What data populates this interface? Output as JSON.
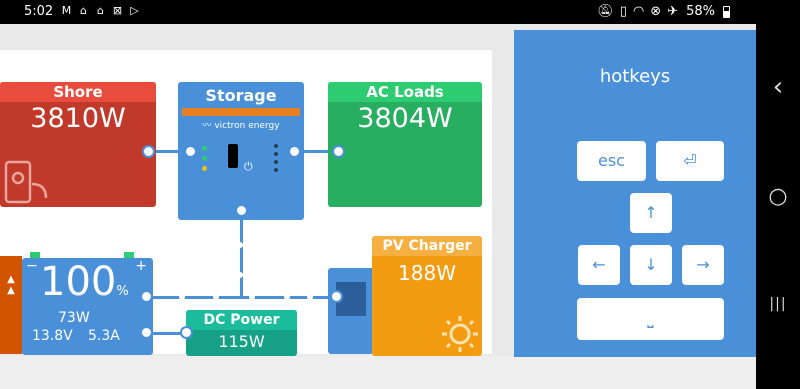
{
  "status_bar": {
    "time": "5:02",
    "battery": "58%"
  },
  "dashboard": {
    "shore": {
      "title": "Shore",
      "value": "3810W"
    },
    "storage": {
      "title": "Storage",
      "brand": "victron energy"
    },
    "ac_loads": {
      "title": "AC Loads",
      "value": "3804W"
    },
    "battery": {
      "percent": "100",
      "percent_unit": "%",
      "power": "73W",
      "voltage": "13.8V",
      "current": "5.3A"
    },
    "dc_power": {
      "title": "DC Power",
      "value": "115W"
    },
    "pv_charger": {
      "title": "PV Charger",
      "value": "188W"
    }
  },
  "hotkeys": {
    "title": "hotkeys",
    "keys": {
      "esc": "esc",
      "enter": "⏎",
      "up": "↑",
      "left": "←",
      "down": "↓",
      "right": "→",
      "space": "⎵"
    }
  },
  "nav": {
    "back": "‹",
    "home": "○",
    "recents": "|||"
  },
  "colors": {
    "shore": "#c0392b",
    "ac_loads": "#27ae60",
    "storage": "#4a90d9",
    "pv_charger": "#f39c12",
    "dc_power": "#16a085"
  }
}
